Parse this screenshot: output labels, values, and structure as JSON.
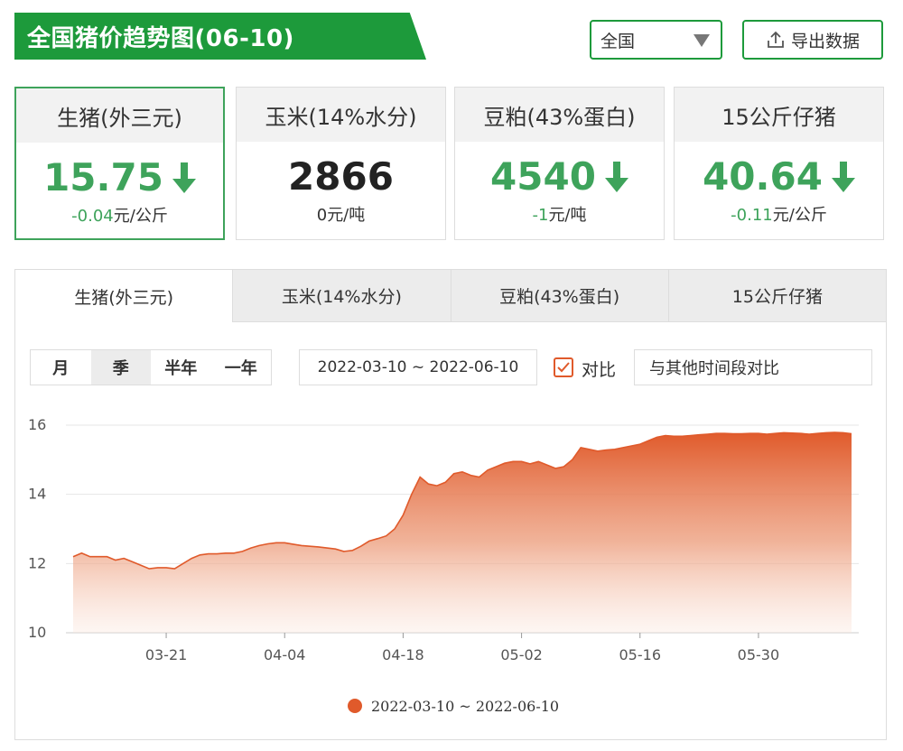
{
  "header": {
    "title": "全国猪价趋势图(06-10)",
    "region_value": "全国",
    "export_label": "导出数据"
  },
  "cards": [
    {
      "name": "生猪(外三元)",
      "value": "15.75",
      "delta": "-0.04",
      "unit": "元/公斤",
      "trend": "down",
      "active": true
    },
    {
      "name": "玉米(14%水分)",
      "value": "2866",
      "delta": "0",
      "unit": "元/吨",
      "trend": "none",
      "active": false
    },
    {
      "name": "豆粕(43%蛋白)",
      "value": "4540",
      "delta": "-1",
      "unit": "元/吨",
      "trend": "down",
      "active": false
    },
    {
      "name": "15公斤仔猪",
      "value": "40.64",
      "delta": "-0.11",
      "unit": "元/公斤",
      "trend": "down",
      "active": false
    }
  ],
  "tabs": [
    "生猪(外三元)",
    "玉米(14%水分)",
    "豆粕(43%蛋白)",
    "15公斤仔猪"
  ],
  "range_buttons": [
    "月",
    "季",
    "半年",
    "一年"
  ],
  "active_range": "季",
  "date_range": "2022-03-10 ~ 2022-06-10",
  "compare_label": "对比",
  "compare_placeholder": "与其他时间段对比",
  "colors": {
    "brand_green": "#1d9a3b",
    "card_green": "#3ea35b",
    "series": "#e05a2b"
  },
  "chart_data": {
    "type": "area",
    "title": "",
    "xlabel": "",
    "ylabel": "",
    "ylim": [
      10,
      16
    ],
    "yticks": [
      10,
      12,
      14,
      16
    ],
    "xticks": [
      "03-21",
      "04-04",
      "04-18",
      "05-02",
      "05-16",
      "05-30"
    ],
    "grid": true,
    "legend_position": "bottom",
    "series": [
      {
        "name": "2022-03-10 ~ 2022-06-10",
        "x": [
          "03-10",
          "03-11",
          "03-12",
          "03-13",
          "03-14",
          "03-15",
          "03-16",
          "03-17",
          "03-18",
          "03-19",
          "03-20",
          "03-21",
          "03-22",
          "03-23",
          "03-24",
          "03-25",
          "03-26",
          "03-27",
          "03-28",
          "03-29",
          "03-30",
          "03-31",
          "04-01",
          "04-02",
          "04-03",
          "04-04",
          "04-05",
          "04-06",
          "04-07",
          "04-08",
          "04-09",
          "04-10",
          "04-11",
          "04-12",
          "04-13",
          "04-14",
          "04-15",
          "04-16",
          "04-17",
          "04-18",
          "04-19",
          "04-20",
          "04-21",
          "04-22",
          "04-23",
          "04-24",
          "04-25",
          "04-26",
          "04-27",
          "04-28",
          "04-29",
          "04-30",
          "05-01",
          "05-02",
          "05-03",
          "05-04",
          "05-05",
          "05-06",
          "05-07",
          "05-08",
          "05-09",
          "05-10",
          "05-11",
          "05-12",
          "05-13",
          "05-14",
          "05-15",
          "05-16",
          "05-17",
          "05-18",
          "05-19",
          "05-20",
          "05-21",
          "05-22",
          "05-23",
          "05-24",
          "05-25",
          "05-26",
          "05-27",
          "05-28",
          "05-29",
          "05-30",
          "05-31",
          "06-01",
          "06-02",
          "06-03",
          "06-04",
          "06-05",
          "06-06",
          "06-07",
          "06-08",
          "06-09",
          "06-10"
        ],
        "values": [
          12.2,
          12.3,
          12.2,
          12.2,
          12.2,
          12.1,
          12.15,
          12.05,
          11.95,
          11.85,
          11.88,
          11.88,
          11.85,
          12.0,
          12.15,
          12.25,
          12.28,
          12.28,
          12.3,
          12.3,
          12.35,
          12.45,
          12.52,
          12.57,
          12.6,
          12.6,
          12.56,
          12.52,
          12.5,
          12.48,
          12.45,
          12.42,
          12.35,
          12.38,
          12.5,
          12.65,
          12.72,
          12.8,
          13.0,
          13.4,
          14.0,
          14.5,
          14.3,
          14.25,
          14.35,
          14.6,
          14.65,
          14.55,
          14.5,
          14.7,
          14.8,
          14.9,
          14.95,
          14.95,
          14.88,
          14.95,
          14.85,
          14.75,
          14.8,
          15.0,
          15.35,
          15.3,
          15.25,
          15.28,
          15.3,
          15.35,
          15.4,
          15.45,
          15.55,
          15.65,
          15.7,
          15.68,
          15.68,
          15.7,
          15.72,
          15.74,
          15.76,
          15.76,
          15.75,
          15.75,
          15.76,
          15.76,
          15.74,
          15.76,
          15.78,
          15.77,
          15.76,
          15.74,
          15.76,
          15.78,
          15.79,
          15.78,
          15.75
        ]
      }
    ]
  }
}
